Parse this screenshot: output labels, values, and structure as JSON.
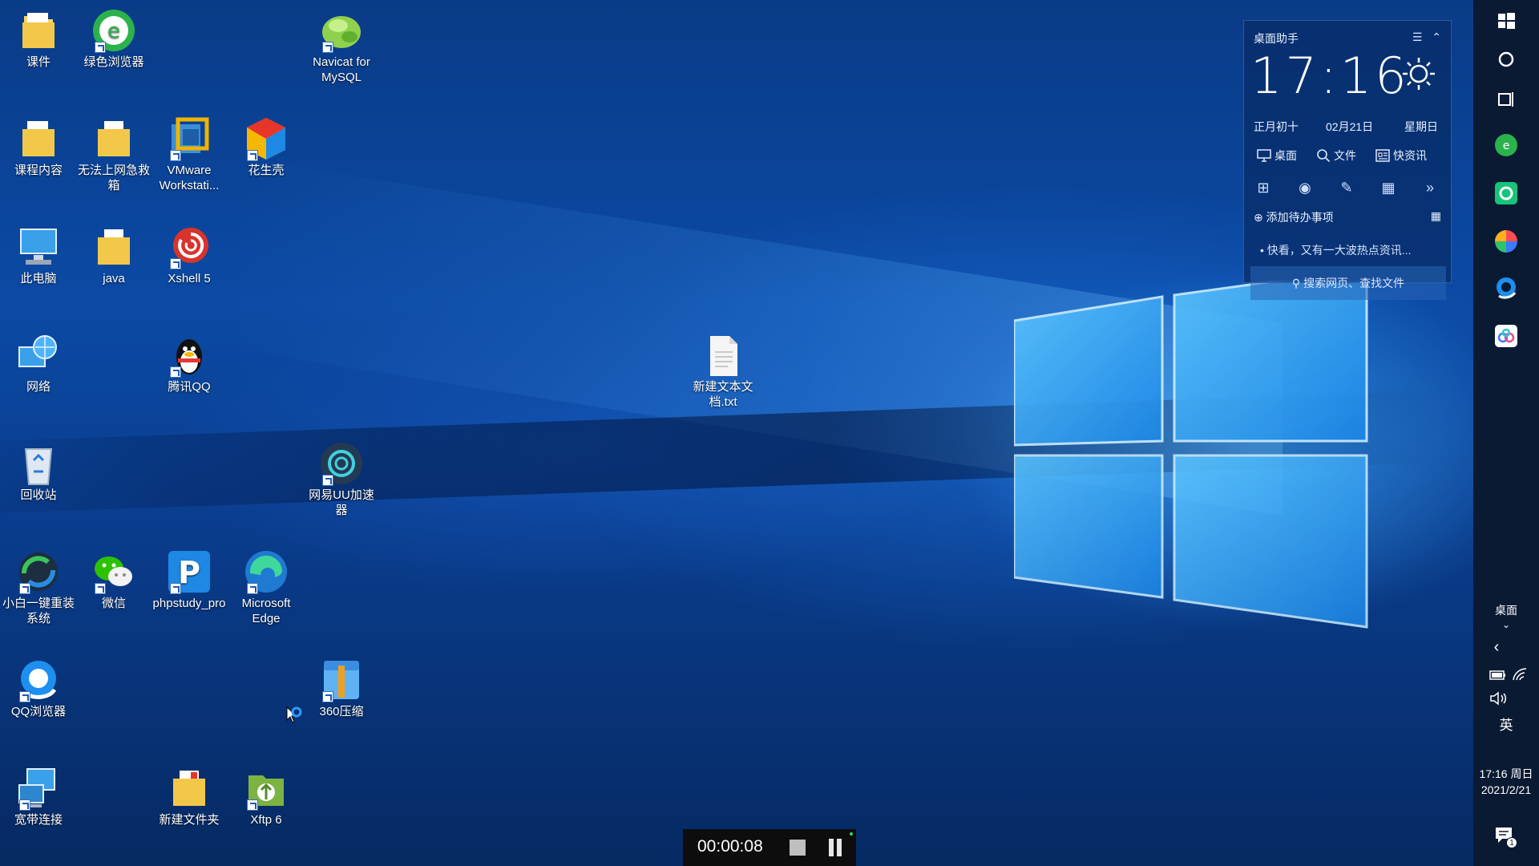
{
  "desktop": {
    "icons": [
      {
        "label": "课件",
        "icon": "folder-icon"
      },
      {
        "label": "绿色浏览器",
        "icon": "green-browser-icon"
      },
      {
        "label": "Navicat for MySQL",
        "icon": "navicat-icon"
      },
      {
        "label": "课程内容",
        "icon": "folder-icon"
      },
      {
        "label": "无法上网急救箱",
        "icon": "folder-icon"
      },
      {
        "label": "VMware Workstati...",
        "icon": "vmware-icon"
      },
      {
        "label": "花生壳",
        "icon": "peanut-shell-icon"
      },
      {
        "label": "此电脑",
        "icon": "computer-icon"
      },
      {
        "label": "java",
        "icon": "folder-icon"
      },
      {
        "label": "Xshell 5",
        "icon": "xshell-icon"
      },
      {
        "label": "网络",
        "icon": "network-icon"
      },
      {
        "label": "腾讯QQ",
        "icon": "qq-icon"
      },
      {
        "label": "新建文本文档.txt",
        "icon": "text-file-icon"
      },
      {
        "label": "回收站",
        "icon": "recycle-bin-icon"
      },
      {
        "label": "网易UU加速器",
        "icon": "uu-accelerator-icon"
      },
      {
        "label": "小白一键重装系统",
        "icon": "xiaobai-reinstall-icon"
      },
      {
        "label": "微信",
        "icon": "wechat-icon"
      },
      {
        "label": "phpstudy_pro",
        "icon": "phpstudy-icon"
      },
      {
        "label": "Microsoft Edge",
        "icon": "edge-icon"
      },
      {
        "label": "QQ浏览器",
        "icon": "qq-browser-icon"
      },
      {
        "label": "360压缩",
        "icon": "360zip-icon"
      },
      {
        "label": "宽带连接",
        "icon": "broadband-icon"
      },
      {
        "label": "新建文件夹",
        "icon": "folder-icon"
      },
      {
        "label": "Xftp 6",
        "icon": "xftp-icon"
      }
    ]
  },
  "widget": {
    "title": "桌面助手",
    "clock": "17:16",
    "lunar_date": "正月初十",
    "date": "02月21日",
    "weekday": "星期日",
    "tabs": [
      "桌面",
      "文件",
      "快资讯"
    ],
    "todo": "添加待办事项",
    "news": "快看，又有一大波热点资讯...",
    "search_placeholder": "搜索网页、查找文件"
  },
  "taskbar": {
    "desktop_label": "桌面",
    "ime": "英",
    "time": "17:16 周日",
    "date": "2021/2/21",
    "notification_count": "1"
  },
  "recorder": {
    "elapsed": "00:00:08"
  },
  "colors": {
    "wallpaper_blue": "#0b4aa5",
    "taskbar_bg": "#0b1a33",
    "widget_bg": "#082d69",
    "recorder_bg": "#0d0d0d"
  }
}
